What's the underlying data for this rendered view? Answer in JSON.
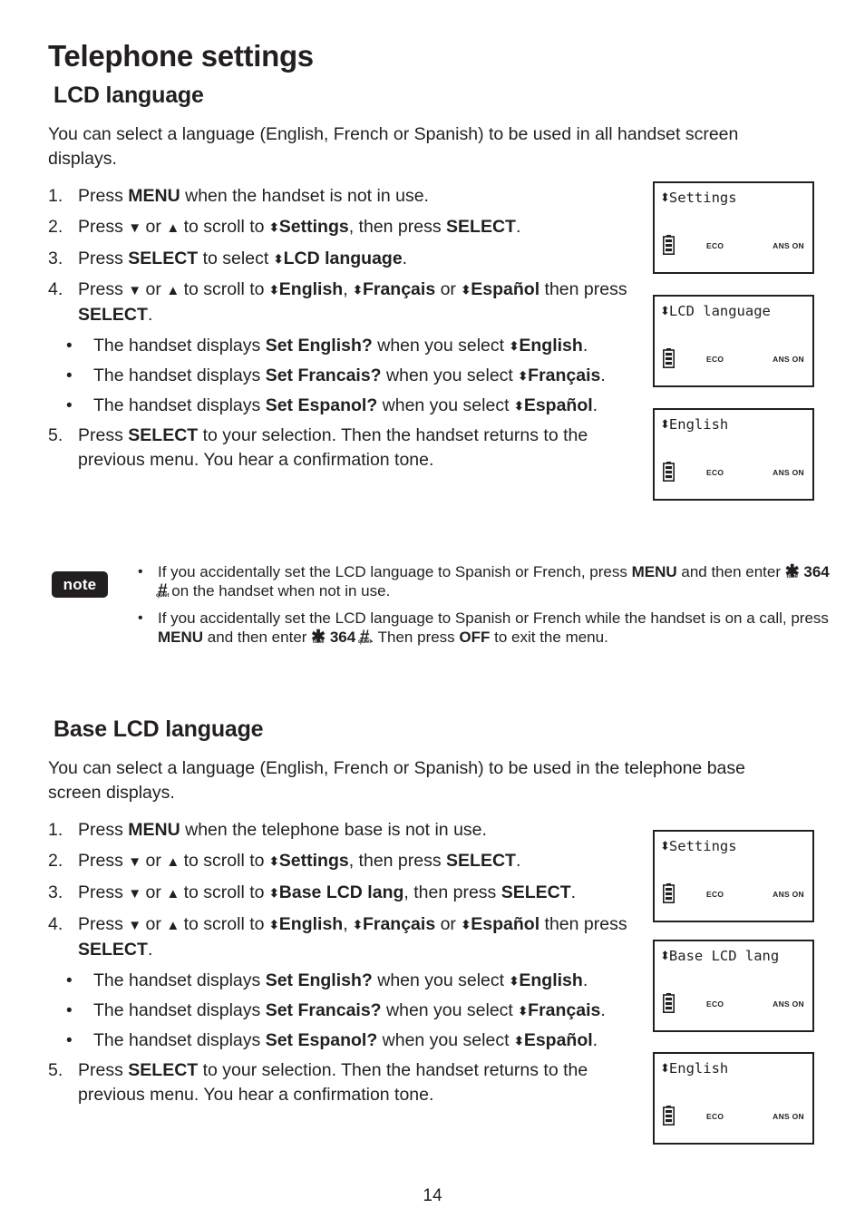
{
  "document": {
    "chapter_title": "Telephone settings",
    "page_number": "14"
  },
  "sections": [
    {
      "heading": "LCD language",
      "intro": "You can select a language (English, French or Spanish) to be used in all handset screen displays.",
      "steps": [
        {
          "num": "1.",
          "html": "Press <b>MENU</b> when the handset is not in use."
        },
        {
          "num": "2.",
          "html": "Press <span class=\"updown\">▼</span> or <span class=\"updown\">▲</span> to scroll to <b><span class=\"arr\">⬍</span>Settings</b>, then press <b>SELECT</b>."
        },
        {
          "num": "3.",
          "html": "Press <b>SELECT</b> to select <b><span class=\"arr\">⬍</span>LCD language</b>."
        },
        {
          "num": "4.",
          "html": "Press <span class=\"updown\">▼</span> or <span class=\"updown\">▲</span> to scroll to <b><span class=\"arr\">⬍</span>English</b>, <b><span class=\"arr\">⬍</span>Français</b> or <b><span class=\"arr\">⬍</span>Español</b> then press <b>SELECT</b>."
        }
      ],
      "bullets": [
        "The handset displays <b>Set English?</b> when you select <b><span class=\"arr\">⬍</span>English</b>.",
        "The handset displays <b>Set Francais?</b> when you select <b><span class=\"arr\">⬍</span>Français</b>.",
        "The handset displays <b>Set Espanol?</b> when you select <b><span class=\"arr\">⬍</span>Español</b>."
      ],
      "final_step": {
        "num": "5.",
        "html": "Press <b>SELECT</b> to your selection. Then the handset returns to the previous menu. You hear a confirmation tone."
      }
    },
    {
      "heading": "Base LCD language",
      "intro": "You can select a language (English, French or Spanish) to be used in the telephone base screen displays.",
      "steps": [
        {
          "num": "1.",
          "html": "Press <b>MENU</b> when the telephone base is not in use."
        },
        {
          "num": "2.",
          "html": "Press <span class=\"updown\">▼</span> or <span class=\"updown\">▲</span> to scroll to <b><span class=\"arr\">⬍</span>Settings</b>, then press <b>SELECT</b>."
        },
        {
          "num": "3.",
          "html": "Press <span class=\"updown\">▼</span> or <span class=\"updown\">▲</span> to scroll to <b><span class=\"arr\">⬍</span>Base LCD lang</b>, then press <b>SELECT</b>."
        },
        {
          "num": "4.",
          "html": "Press <span class=\"updown\">▼</span> or <span class=\"updown\">▲</span> to scroll to <b><span class=\"arr\">⬍</span>English</b>, <b><span class=\"arr\">⬍</span>Français</b> or <b><span class=\"arr\">⬍</span>Español</b> then press <b>SELECT</b>."
        }
      ],
      "bullets": [
        "The handset displays <b>Set English?</b> when you select <b><span class=\"arr\">⬍</span>English</b>.",
        "The handset displays <b>Set Francais?</b> when you select <b><span class=\"arr\">⬍</span>Français</b>.",
        "The handset displays <b>Set Espanol?</b> when you select <b><span class=\"arr\">⬍</span>Español</b>."
      ],
      "final_step": {
        "num": "5.",
        "html": "Press <b>SELECT</b> to your selection. Then the handset returns to the previous menu. You hear a confirmation tone."
      }
    }
  ],
  "note": {
    "badge_label": "note",
    "items": [
      "If you accidentally set the LCD language to Spanish or French, press <b>MENU</b> and then enter <span class=\"keysym\"><span class=\"glyph\">✱</span><span class=\"sub\">tone</span></span> <b>364</b> <span class=\"keysym\"><span class=\"glyph\">#</span><span class=\"sub\">quiet</span></span> on the handset when not in use.",
      "If you accidentally set the LCD language to Spanish or French while the handset is on a call, press <b>MENU</b> and then enter <span class=\"keysym\"><span class=\"glyph\">✱</span><span class=\"sub\">tone</span></span> <b>364</b> <span class=\"keysym\"><span class=\"glyph\">#</span><span class=\"sub\">quiet</span></span>. Then press <b>OFF</b> to exit the menu."
    ]
  },
  "lcd_screens": [
    {
      "id": "lcd-1",
      "title": "Settings",
      "eco": "ECO",
      "ans": "ANS ON",
      "battery": "battery-full"
    },
    {
      "id": "lcd-2",
      "title": "LCD language",
      "eco": "ECO",
      "ans": "ANS ON",
      "battery": "battery-full"
    },
    {
      "id": "lcd-3",
      "title": "English",
      "eco": "ECO",
      "ans": "ANS ON",
      "battery": "battery-full"
    },
    {
      "id": "lcd-4",
      "title": "Settings",
      "eco": "ECO",
      "ans": "ANS ON",
      "battery": "battery-full"
    },
    {
      "id": "lcd-5",
      "title": "Base LCD lang",
      "eco": "ECO",
      "ans": "ANS ON",
      "battery": "battery-full"
    },
    {
      "id": "lcd-6",
      "title": "English",
      "eco": "ECO",
      "ans": "ANS ON",
      "battery": "battery-full"
    }
  ],
  "colors": {
    "text": "#231f20",
    "note_badge_bg": "#231f20",
    "note_badge_fg": "#ffffff",
    "lcd_border": "#231f20",
    "page_bg": "#ffffff"
  }
}
